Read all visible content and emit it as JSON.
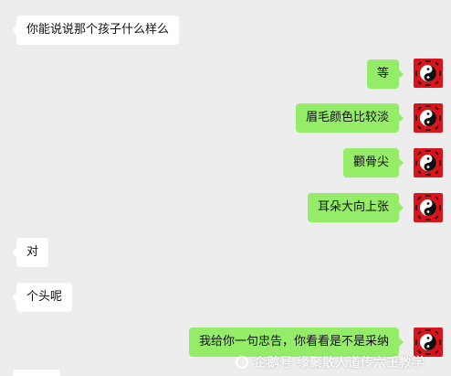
{
  "messages": [
    {
      "side": "in",
      "text": "你能说说那个孩子什么样么"
    },
    {
      "side": "out",
      "text": "等"
    },
    {
      "side": "out",
      "text": "眉毛颜色比较淡"
    },
    {
      "side": "out",
      "text": "颧骨尖"
    },
    {
      "side": "out",
      "text": "耳朵大向上张"
    },
    {
      "side": "in",
      "text": "对"
    },
    {
      "side": "in",
      "text": "个头呢"
    },
    {
      "side": "out",
      "text": "我给你一句忠告，你看看是不是采纳"
    }
  ],
  "avatar_icon": "yin-yang-bagua-icon",
  "watermark": {
    "text": "企鹅号 缘聚散人道传六壬教学"
  },
  "colors": {
    "background": "#ededed",
    "incoming": "#ffffff",
    "outgoing": "#95ec69",
    "avatar": "#d9141b"
  }
}
